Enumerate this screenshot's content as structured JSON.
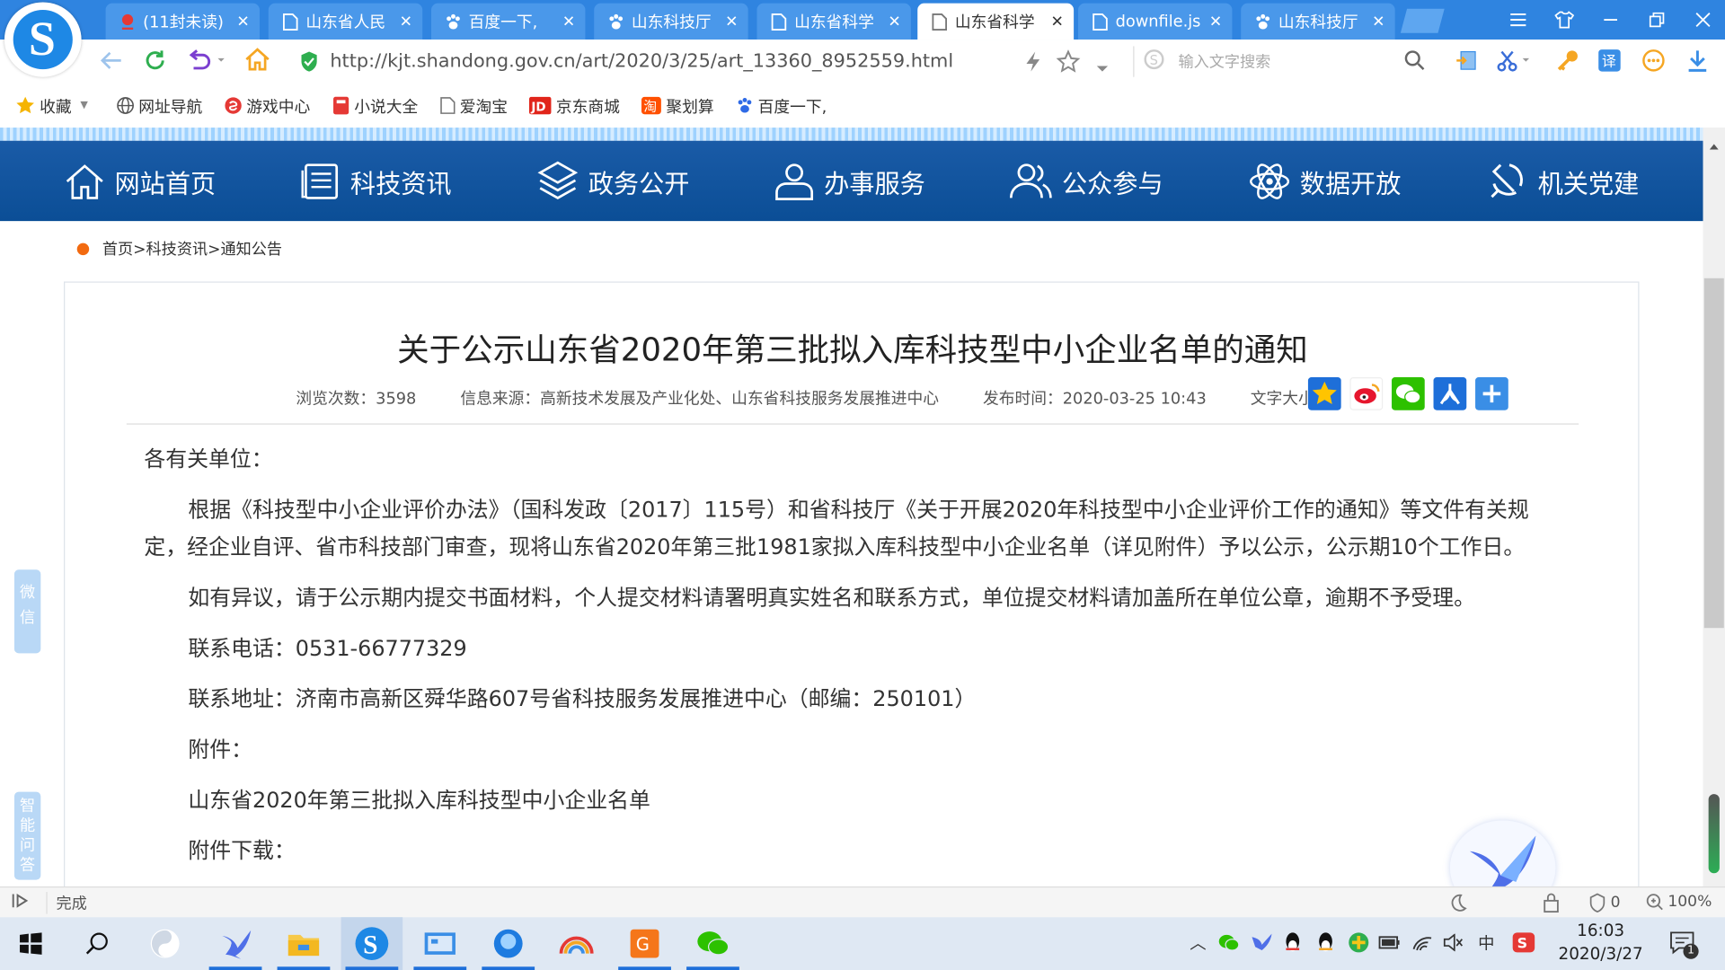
{
  "browser": {
    "tabs": [
      {
        "title": "(11封未读)",
        "icon": "mail-icon"
      },
      {
        "title": "山东省人民",
        "icon": "page-icon"
      },
      {
        "title": "百度一下,",
        "icon": "baidu-paw-icon"
      },
      {
        "title": "山东科技厅",
        "icon": "baidu-paw-icon"
      },
      {
        "title": "山东省科学",
        "icon": "page-icon"
      },
      {
        "title": "山东省科学",
        "icon": "page-icon"
      },
      {
        "title": "downfile.js",
        "icon": "page-icon"
      },
      {
        "title": "山东科技厅",
        "icon": "baidu-paw-icon"
      }
    ],
    "active_tab": 5,
    "url": "http://kjt.shandong.gov.cn/art/2020/3/25/art_13360_8952559.html",
    "search_placeholder": "输入文字搜索",
    "bookmarks": [
      {
        "label": "收藏",
        "icon": "star-icon"
      },
      {
        "label": "网址导航",
        "icon": "globe-icon"
      },
      {
        "label": "游戏中心",
        "icon": "game-icon"
      },
      {
        "label": "小说大全",
        "icon": "book-icon"
      },
      {
        "label": "爱淘宝",
        "icon": "page-icon"
      },
      {
        "label": "京东商城",
        "icon": "jd-icon"
      },
      {
        "label": "聚划算",
        "icon": "taobao-icon"
      },
      {
        "label": "百度一下,",
        "icon": "baidu-paw-icon"
      }
    ],
    "status_text": "完成",
    "status_count": "0",
    "zoom": "100%"
  },
  "site": {
    "nav": [
      {
        "label": "网站首页",
        "icon": "home-icon"
      },
      {
        "label": "科技资讯",
        "icon": "news-icon"
      },
      {
        "label": "政务公开",
        "icon": "layers-icon"
      },
      {
        "label": "办事服务",
        "icon": "person-icon"
      },
      {
        "label": "公众参与",
        "icon": "people-icon"
      },
      {
        "label": "数据开放",
        "icon": "atom-icon"
      },
      {
        "label": "机关党建",
        "icon": "party-icon"
      }
    ],
    "breadcrumb": "首页>科技资讯>通知公告",
    "side_wechat": "微信",
    "side_qa": "智能问答"
  },
  "article": {
    "title": "关于公示山东省2020年第三批拟入库科技型中小企业名单的通知",
    "views_label": "浏览次数：3598",
    "source_label": "信息来源：高新技术发展及产业化处、山东省科技服务发展推进中心",
    "published_label": "发布时间：2020-03-25 10:43",
    "fontsize_label": "文字大小",
    "greeting": "各有关单位：",
    "para1": "根据《科技型中小企业评价办法》（国科发政〔2017〕115号）和省科技厅《关于开展2020年科技型中小企业评价工作的通知》等文件有关规定，经企业自评、省市科技部门审查，现将山东省2020年第三批1981家拟入库科技型中小企业名单（详见附件）予以公示，公示期10个工作日。",
    "para2": "如有异议，请于公示期内提交书面材料，个人提交材料请署明真实姓名和联系方式，单位提交材料请加盖所在单位公章，逾期不予受理。",
    "phone": "联系电话：0531-66777329",
    "address": "联系地址：济南市高新区舜华路607号省科技服务发展推进中心（邮编：250101）",
    "attachment_label": "附件：",
    "attachment_name": "山东省2020年第三批拟入库科技型中小企业名单",
    "download_label": "附件下载："
  },
  "taskbar": {
    "time": "16:03",
    "date": "2020/3/27",
    "ime": "中",
    "notification_count": "1"
  },
  "colors": {
    "nav_bg": "#0b4e96",
    "tabbar_bg": "#2f84e0",
    "breadcrumb_dot": "#f26a10"
  }
}
